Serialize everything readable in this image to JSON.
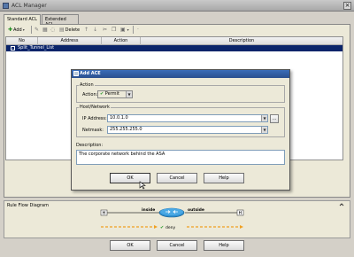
{
  "window": {
    "title": "ACL Manager",
    "close_glyph": "×"
  },
  "tabs": [
    {
      "label": "Standard ACL",
      "active": true
    },
    {
      "label": "Extended ACL",
      "active": false
    }
  ],
  "toolbar": {
    "add_label": "Add",
    "delete_label": "Delete",
    "icons": [
      "add-icon",
      "edit-icon",
      "properties-icon",
      "delete-icon",
      "move-up-icon",
      "move-down-icon",
      "cut-icon",
      "copy-icon",
      "paste-icon"
    ]
  },
  "table": {
    "columns": [
      "No",
      "Address",
      "Action",
      "Description"
    ],
    "rows": [
      {
        "toggle": "-",
        "name": "Split_Tunnel_List"
      }
    ]
  },
  "rule_flow": {
    "label": "Rule Flow Diagram",
    "left_interface": "inside",
    "right_interface": "outside",
    "action": "deny"
  },
  "main_buttons": {
    "ok": "OK",
    "cancel": "Cancel",
    "help": "Help"
  },
  "dialog": {
    "title": "Add ACE",
    "action_group": "Action",
    "action_label": "Action:",
    "action_value": "Permit",
    "host_group": "Host/Network",
    "ip_label": "IP Address:",
    "ip_value": "10.0.1.0",
    "netmask_label": "Netmask:",
    "netmask_value": "255.255.255.0",
    "description_label": "Description:",
    "description_value": "The corporate network behind the ASA",
    "ok": "OK",
    "cancel": "Cancel",
    "help": "Help",
    "ellipsis": "..."
  },
  "colors": {
    "selection": "#0a246a",
    "title_blue": "#2a4f8f",
    "permit_green": "#2a9a2a",
    "flow_orange": "#f0a020",
    "router_blue": "#2f8fd0"
  }
}
